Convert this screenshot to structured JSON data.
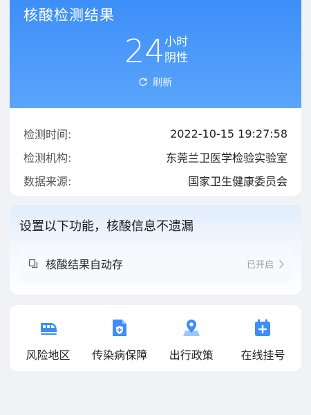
{
  "result": {
    "title": "核酸检测结果",
    "hours": "24",
    "unit": "小时",
    "status": "阴性",
    "refresh_label": "刷新"
  },
  "info": [
    {
      "label": "检测时间:",
      "value": "2022-10-15 19:27:58"
    },
    {
      "label": "检测机构:",
      "value": "东莞兰卫医学检验实验室"
    },
    {
      "label": "数据来源:",
      "value": "国家卫生健康委员会"
    }
  ],
  "settings": {
    "title": "设置以下功能，核酸信息不遗漏",
    "item": {
      "label": "核酸结果自动存",
      "state": "已开启"
    }
  },
  "services": [
    {
      "label": "风险地区",
      "icon": "train-icon"
    },
    {
      "label": "传染病保障",
      "icon": "document-shield-icon"
    },
    {
      "label": "出行政策",
      "icon": "map-pin-icon"
    },
    {
      "label": "在线挂号",
      "icon": "medical-calendar-icon"
    }
  ],
  "colors": {
    "accent": "#3d8ef8",
    "header_gradient_end": "#5aa5fb",
    "background": "#f0f2f6"
  }
}
